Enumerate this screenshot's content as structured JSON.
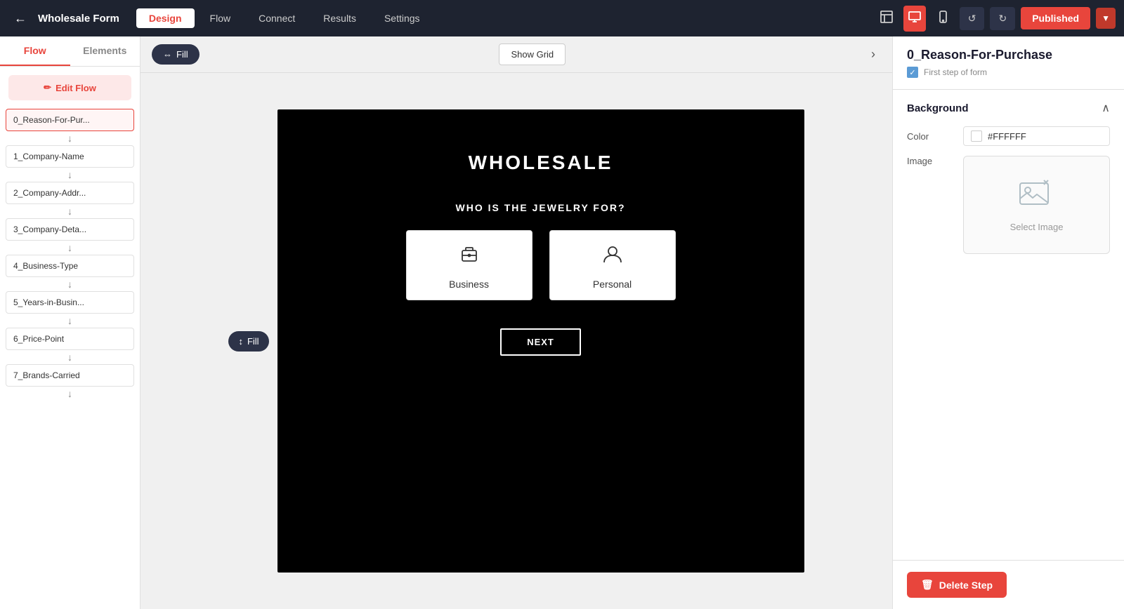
{
  "topbar": {
    "back_icon": "←",
    "title": "Wholesale Form",
    "tabs": [
      {
        "label": "Design",
        "active": true
      },
      {
        "label": "Flow",
        "active": false
      },
      {
        "label": "Connect",
        "active": false
      },
      {
        "label": "Results",
        "active": false
      },
      {
        "label": "Settings",
        "active": false
      }
    ],
    "view_desktop_icon": "🖥",
    "view_tablet_icon": "📱",
    "view_mobile_icon": "📲",
    "undo_icon": "↺",
    "redo_icon": "↻",
    "published_label": "Published",
    "caret_icon": "▼"
  },
  "sidebar": {
    "tabs": [
      {
        "label": "Flow",
        "active": true
      },
      {
        "label": "Elements",
        "active": false
      }
    ],
    "edit_flow_label": "Edit Flow",
    "flow_items": [
      {
        "label": "0_Reason-For-Pur...",
        "active": true
      },
      {
        "label": "1_Company-Name",
        "active": false
      },
      {
        "label": "2_Company-Addr...",
        "active": false
      },
      {
        "label": "3_Company-Deta...",
        "active": false
      },
      {
        "label": "4_Business-Type",
        "active": false
      },
      {
        "label": "5_Years-in-Busin...",
        "active": false
      },
      {
        "label": "6_Price-Point",
        "active": false
      },
      {
        "label": "7_Brands-Carried",
        "active": false
      }
    ]
  },
  "canvas": {
    "fill_label": "Fill",
    "show_grid_label": "Show Grid",
    "preview": {
      "title": "WHOLESALE",
      "question": "WHO IS THE JEWELRY FOR?",
      "options": [
        {
          "label": "Business",
          "icon": "briefcase"
        },
        {
          "label": "Personal",
          "icon": "person"
        }
      ],
      "next_label": "NEXT"
    }
  },
  "right_panel": {
    "title": "0_Reason-For-Purchase",
    "first_step_label": "First step of form",
    "background_section": {
      "title": "Background",
      "color_label": "Color",
      "color_value": "#FFFFFF",
      "image_label": "Image",
      "select_image_label": "Select Image"
    },
    "delete_step_label": "Delete Step"
  }
}
